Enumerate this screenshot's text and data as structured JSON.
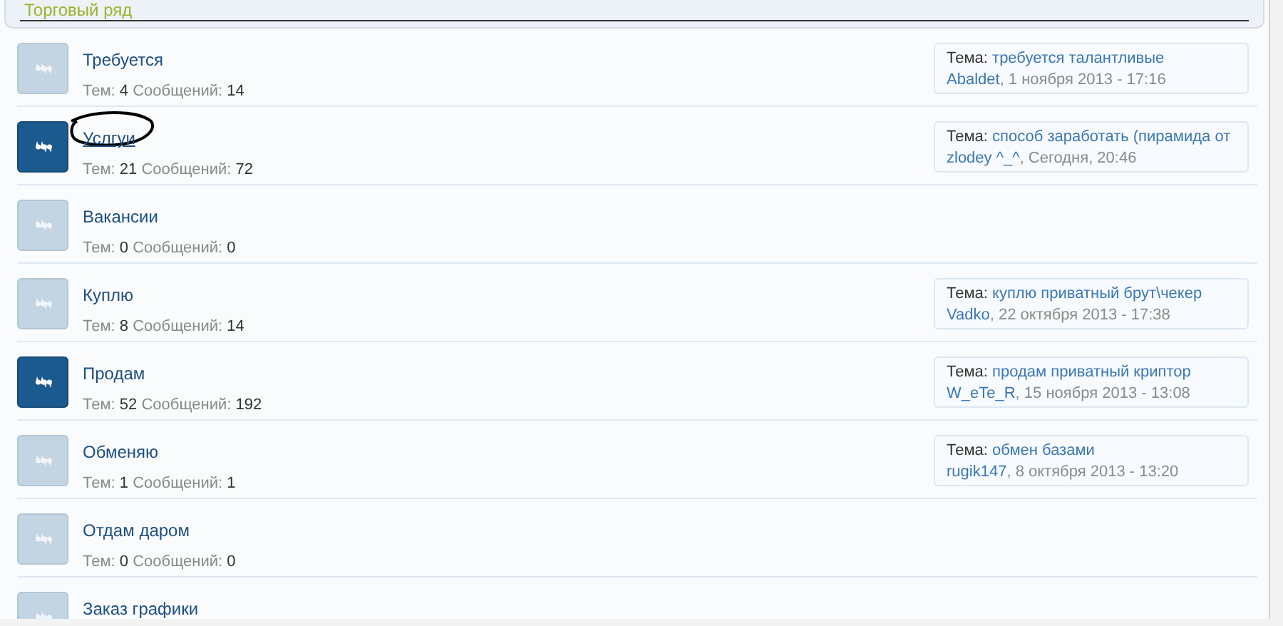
{
  "section": {
    "title": "Торговый ряд"
  },
  "forums": [
    {
      "name": "Требуется",
      "unread": false,
      "circled": false,
      "topics_label": "Тем:",
      "topics": "4",
      "posts_label": "Сообщений:",
      "posts": "14",
      "last_post": {
        "label": "Тема:",
        "topic": "требуется талантливые",
        "author": "Abaldet",
        "date": ", 1 ноября 2013 - 17:16"
      }
    },
    {
      "name": "Услгуи",
      "unread": true,
      "circled": true,
      "topics_label": "Тем:",
      "topics": "21",
      "posts_label": "Сообщений:",
      "posts": "72",
      "last_post": {
        "label": "Тема:",
        "topic": "способ заработать (пирамида от",
        "author": "zlodey ^_^",
        "date": ", Сегодня, 20:46"
      }
    },
    {
      "name": "Вакансии",
      "unread": false,
      "circled": false,
      "topics_label": "Тем:",
      "topics": "0",
      "posts_label": "Сообщений:",
      "posts": "0"
    },
    {
      "name": "Куплю",
      "unread": false,
      "circled": false,
      "topics_label": "Тем:",
      "topics": "8",
      "posts_label": "Сообщений:",
      "posts": "14",
      "last_post": {
        "label": "Тема:",
        "topic": "куплю приватный брут\\чекер",
        "author": "Vadko",
        "date": ", 22 октября 2013 - 17:38"
      }
    },
    {
      "name": "Продам",
      "unread": true,
      "circled": false,
      "topics_label": "Тем:",
      "topics": "52",
      "posts_label": "Сообщений:",
      "posts": "192",
      "last_post": {
        "label": "Тема:",
        "topic": "продам приватный криптор",
        "author": "W_eTe_R",
        "date": ", 15 ноября 2013 - 13:08"
      }
    },
    {
      "name": "Обменяю",
      "unread": false,
      "circled": false,
      "topics_label": "Тем:",
      "topics": "1",
      "posts_label": "Сообщений:",
      "posts": "1",
      "last_post": {
        "label": "Тема:",
        "topic": "обмен базами",
        "author": "rugik147",
        "date": ", 8 октября 2013 - 13:20"
      }
    },
    {
      "name": "Отдам даром",
      "unread": false,
      "circled": false,
      "topics_label": "Тем:",
      "topics": "0",
      "posts_label": "Сообщений:",
      "posts": "0"
    },
    {
      "name": "Заказ графики",
      "unread": false,
      "circled": false
    }
  ]
}
